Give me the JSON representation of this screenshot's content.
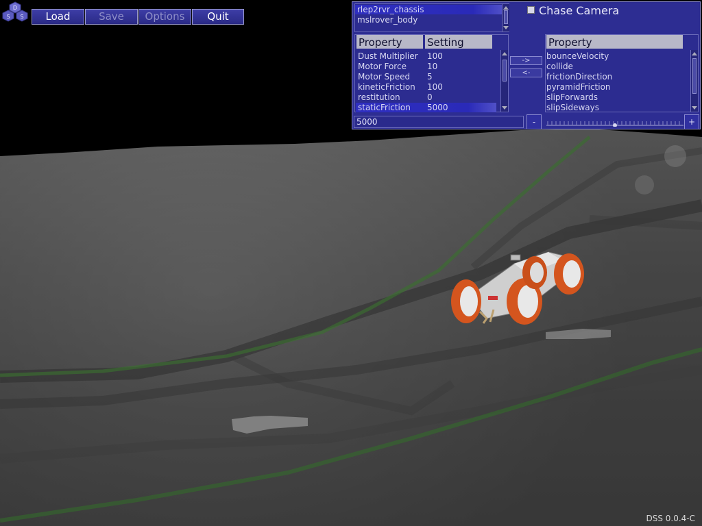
{
  "logo": {
    "letters": [
      "D",
      "S",
      "S"
    ]
  },
  "menu": {
    "load": "Load",
    "save": "Save",
    "options": "Options",
    "quit": "Quit"
  },
  "panel": {
    "objects": [
      "rlep2rvr_chassis",
      "mslrover_body"
    ],
    "selected_object": "rlep2rvr_chassis",
    "chase_camera_label": "Chase Camera",
    "chase_camera_checked": false,
    "properties_table": {
      "headers": [
        "Property",
        "Setting"
      ],
      "rows": [
        {
          "property": "Dust Multiplier",
          "setting": "100"
        },
        {
          "property": "Motor Force",
          "setting": "10"
        },
        {
          "property": "Motor Speed",
          "setting": "5"
        },
        {
          "property": "kineticFriction",
          "setting": "100"
        },
        {
          "property": "restitution",
          "setting": "0"
        },
        {
          "property": "staticFriction",
          "setting": "5000"
        }
      ],
      "selected": "staticFriction"
    },
    "add_arrow": "->",
    "remove_arrow": "<-",
    "available_header": "Property",
    "available_properties": [
      "bounceVelocity",
      "collide",
      "frictionDirection",
      "pyramidFriction",
      "slipForwards",
      "slipSideways"
    ],
    "value_field": "5000",
    "minus_label": "-",
    "plus_label": "+"
  },
  "version": "DSS 0.0.4-C",
  "colors": {
    "panel_bg": "#2d2d92",
    "header_bg": "#b8b8c8",
    "selection": "#2f2fc0",
    "rover_wheel": "#d4551e",
    "terrain": "#5a5a5a"
  }
}
